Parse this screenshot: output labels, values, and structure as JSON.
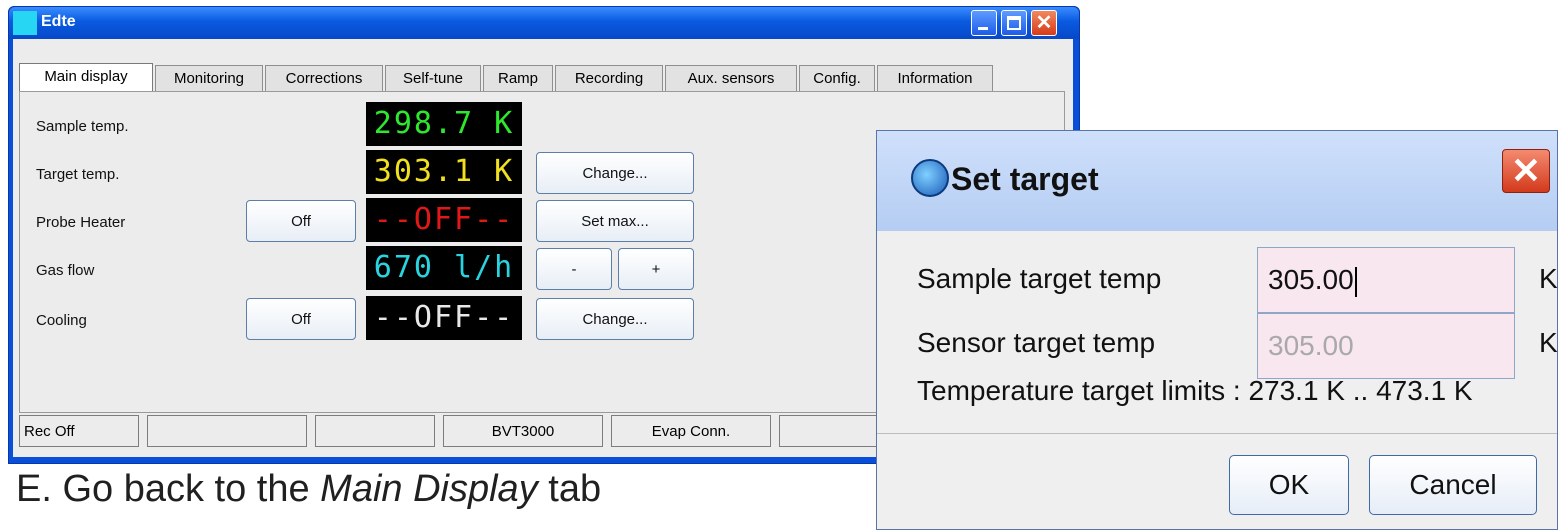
{
  "window": {
    "title": "Edte",
    "tabs": [
      "Main display",
      "Monitoring",
      "Corrections",
      "Self-tune",
      "Ramp",
      "Recording",
      "Aux. sensors",
      "Config.",
      "Information"
    ],
    "rows": [
      {
        "label": "Sample temp.",
        "display": "298.7 K",
        "display_color": "#2ee82e"
      },
      {
        "label": "Target temp.",
        "display": "303.1 K",
        "display_color": "#f0e020",
        "action": "Change..."
      },
      {
        "label": "Probe Heater",
        "toggle": "Off",
        "display": "--OFF--",
        "display_color": "#e01818",
        "action": "Set max..."
      },
      {
        "label": "Gas flow",
        "display": "670 l/h",
        "display_color": "#28d4e0",
        "minus": "-",
        "plus": "+"
      },
      {
        "label": "Cooling",
        "toggle": "Off",
        "display": "--OFF--",
        "display_color": "#e8e8e8",
        "action": "Change..."
      }
    ],
    "status": [
      "Rec Off",
      "",
      "",
      "BVT3000",
      "Evap Conn.",
      ""
    ]
  },
  "caption": {
    "prefix": "E.  Go back to the ",
    "emph": "Main Display",
    "suffix": " tab"
  },
  "dialog": {
    "title": "Set target",
    "sample_label": "Sample target temp",
    "sample_value": "305.00",
    "sensor_label": "Sensor target temp",
    "sensor_value": "305.00",
    "unit": "K",
    "limits": "Temperature target limits : 273.1 K .. 473.1 K",
    "ok": "OK",
    "cancel": "Cancel"
  }
}
